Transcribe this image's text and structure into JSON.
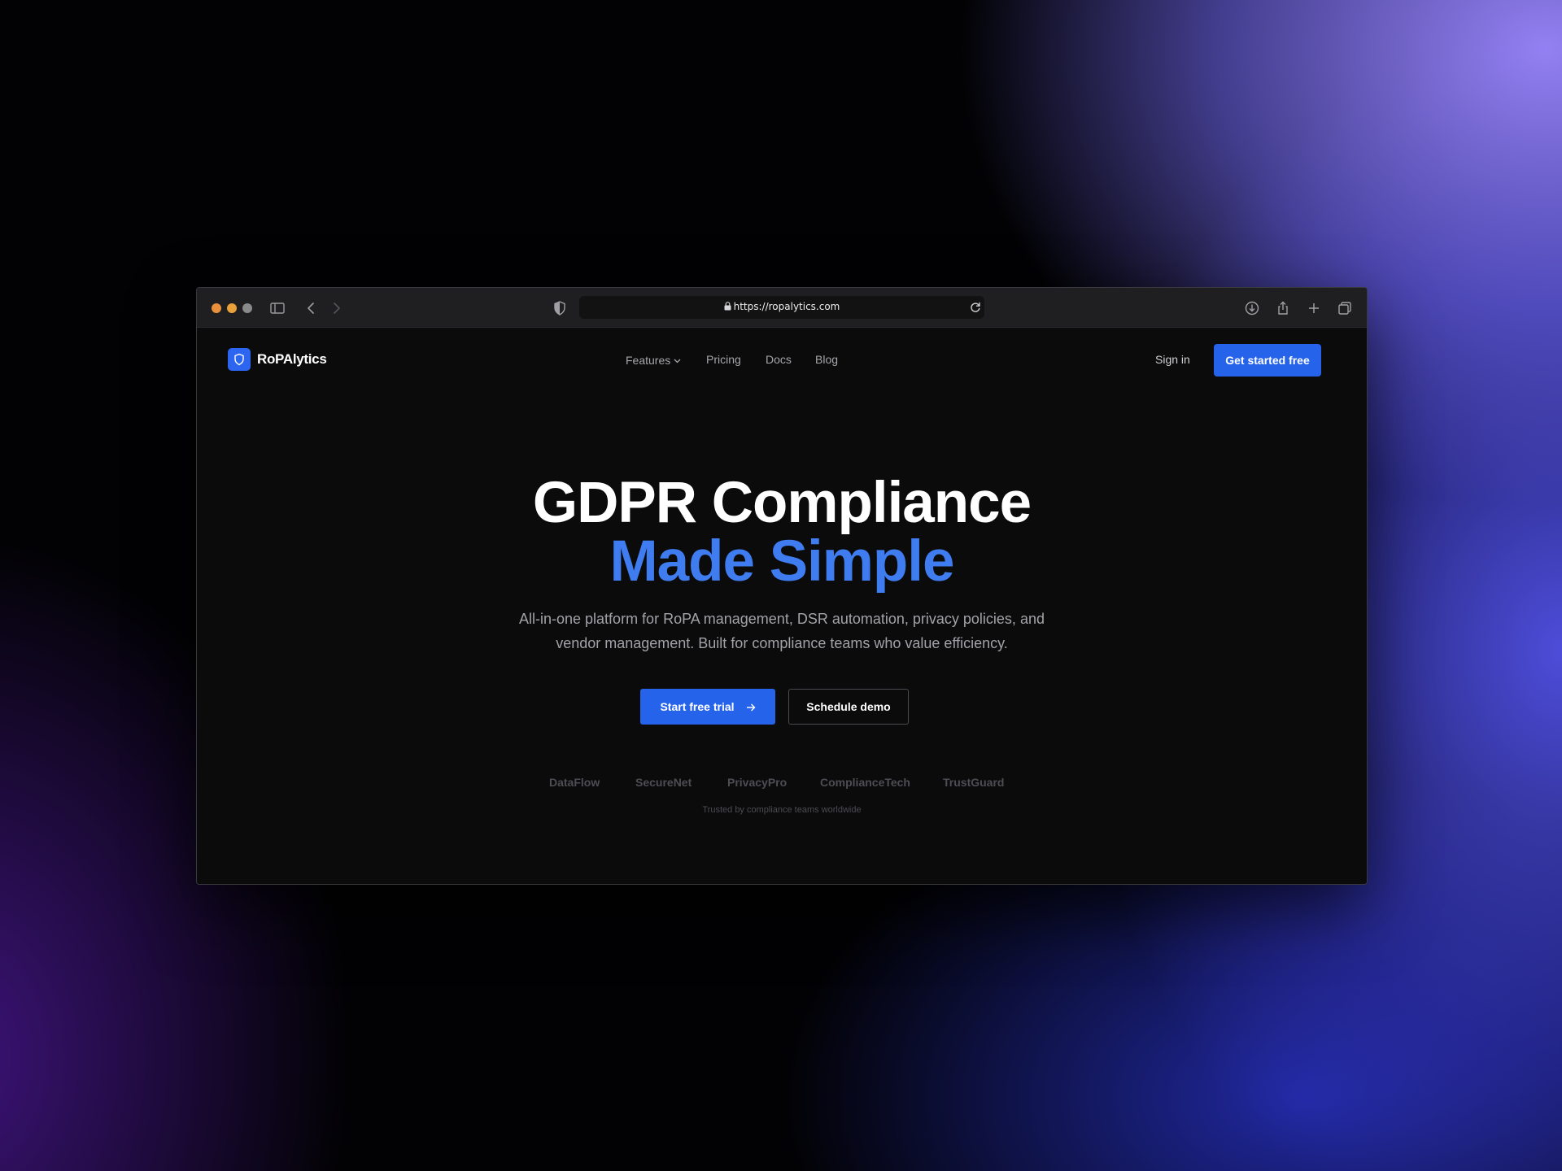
{
  "browser": {
    "url": "https://ropalytics.com"
  },
  "nav": {
    "brand": "RoPAlytics",
    "links": [
      "Features",
      "Pricing",
      "Docs",
      "Blog"
    ],
    "sign_in": "Sign in",
    "cta": "Get started free"
  },
  "hero": {
    "title_line1": "GDPR Compliance",
    "title_line2": "Made Simple",
    "subtitle_line1": "All-in-one platform for RoPA management, DSR automation, privacy policies, and",
    "subtitle_line2": "vendor management. Built for compliance teams who value efficiency.",
    "primary_button": "Start free trial",
    "secondary_button": "Schedule demo"
  },
  "trust": {
    "partners": [
      "DataFlow",
      "SecureNet",
      "PrivacyPro",
      "ComplianceTech",
      "TrustGuard"
    ],
    "caption": "Trusted by compliance teams worldwide"
  },
  "colors": {
    "accent": "#2563eb",
    "headline_accent": "#3f7cf0",
    "page_background": "#0b0b0c"
  },
  "icons": {
    "privacy": "shield-half-icon",
    "sidebar": "sidebar-icon",
    "back": "chevron-left-icon",
    "forward": "chevron-right-icon",
    "reload": "reload-icon",
    "download": "download-icon",
    "share": "share-icon",
    "new_tab": "plus-icon",
    "tabs": "tabs-overview-icon",
    "brand": "shield-icon"
  }
}
